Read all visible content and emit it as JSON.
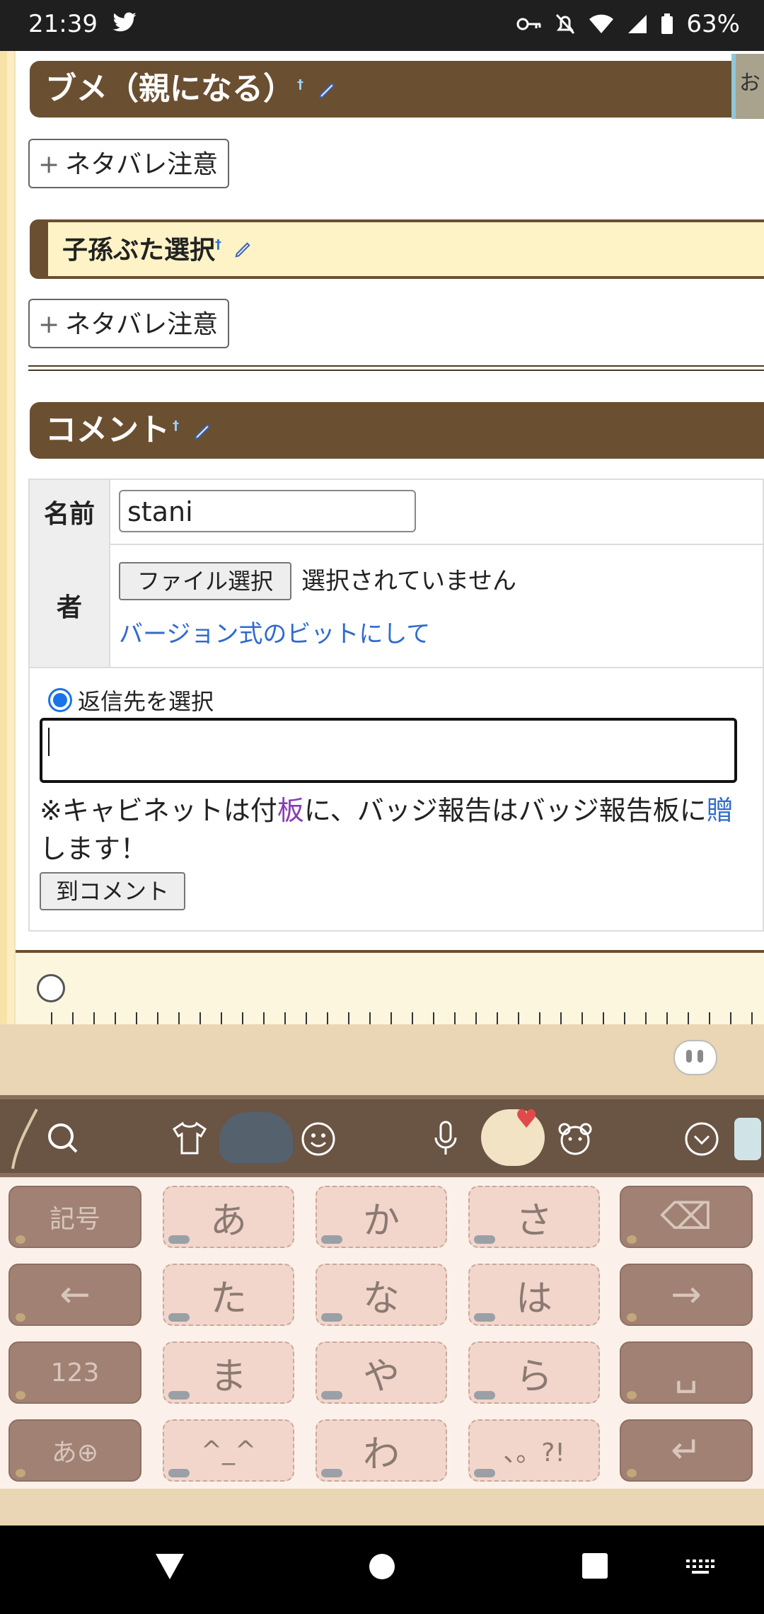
{
  "status_bar": {
    "time": "21:39",
    "battery": "63%",
    "icons": [
      "twitter-icon",
      "key-icon",
      "mute-icon",
      "wifi-icon",
      "signal-icon",
      "battery-icon"
    ]
  },
  "page": {
    "heading1": "ブメ（親になる）",
    "heading1_sup": "†",
    "side_tab": "お",
    "spoiler1": "ネタバレ注意",
    "heading2": "子孫ぶた選択",
    "heading2_sup": "†",
    "spoiler2": "ネタバレ注意",
    "heading3": "コメント",
    "heading3_sup": "†"
  },
  "form": {
    "name_label": "名前",
    "name_value": "stani",
    "file_label": "者",
    "file_button": "ファイル選択",
    "file_status": "選択されていません",
    "link_text": "バージョン式のビットにして",
    "radio_label": "返信先を選択",
    "note_part1": "※キャビネットは付",
    "note_hl1": "板",
    "note_part2": "に、バッジ報告はバッジ報告板に",
    "note_hl2": "贈",
    "note_part3": "します！",
    "submit": "到コメント"
  },
  "keyboard": {
    "rows": [
      [
        "記号",
        "あ",
        "か",
        "さ",
        "⌫"
      ],
      [
        "←",
        "た",
        "な",
        "は",
        "→"
      ],
      [
        "123",
        "ま",
        "や",
        "ら",
        "␣"
      ],
      [
        "あ⊕",
        "^_^",
        "わ",
        "、。?!",
        "↵"
      ]
    ]
  },
  "colors": {
    "header_brown": "#6b4f31",
    "accent_blue": "#1a73e8",
    "link_blue": "#2f6bd0"
  }
}
